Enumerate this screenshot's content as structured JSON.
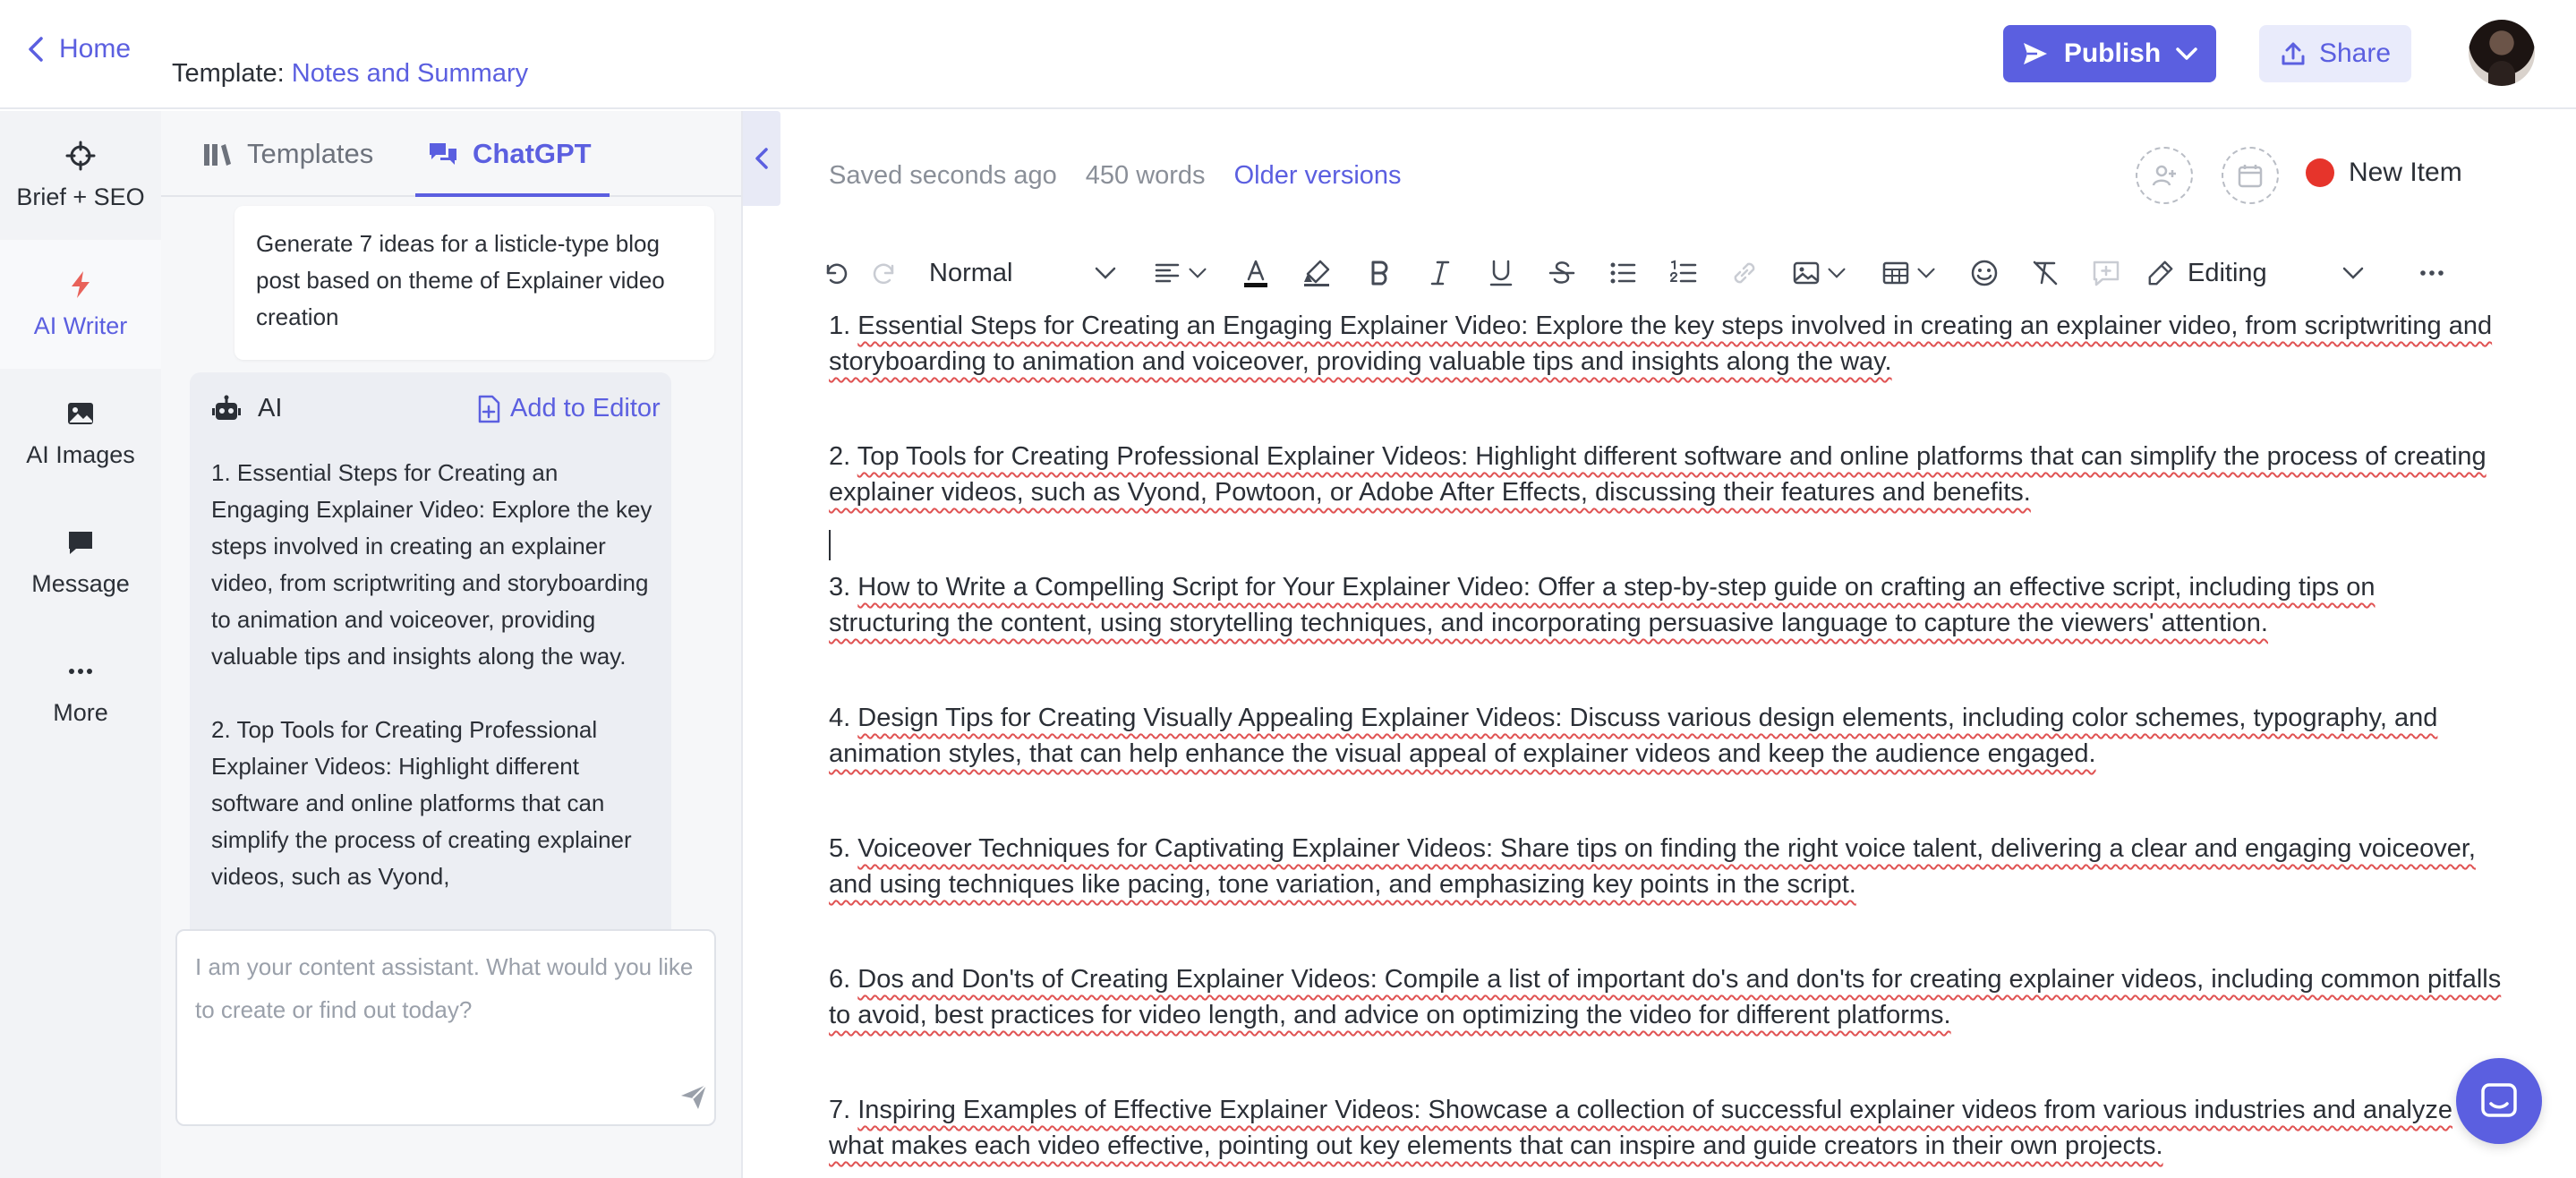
{
  "header": {
    "home_label": "Home",
    "template_prefix": "Template:",
    "template_name": "Notes and Summary",
    "publish_label": "Publish",
    "share_label": "Share"
  },
  "leftnav": {
    "items": [
      {
        "label": "Brief + SEO",
        "icon": "crosshair-icon"
      },
      {
        "label": "AI Writer",
        "icon": "lightning-icon"
      },
      {
        "label": "AI Images",
        "icon": "image-icon"
      },
      {
        "label": "Message",
        "icon": "message-icon"
      },
      {
        "label": "More",
        "icon": "more-icon"
      }
    ]
  },
  "chat": {
    "tabs": [
      {
        "label": "Templates"
      },
      {
        "label": "ChatGPT"
      }
    ],
    "prompt": "Generate 7 ideas for a listicle-type blog post based on theme of Explainer video creation",
    "ai_label": "AI",
    "add_to_editor": "Add to Editor",
    "response": [
      "1. Essential Steps for Creating an Engaging Explainer Video: Explore the key steps involved in creating an explainer video, from scriptwriting and storyboarding to animation and voiceover, providing valuable tips and insights along the way.",
      "2. Top Tools for Creating Professional Explainer Videos: Highlight different software and online platforms that can simplify the process of creating explainer videos, such as Vyond,"
    ],
    "input_placeholder": "I am your content assistant. What would you like to create or find out today?"
  },
  "editor": {
    "saved_status": "Saved seconds ago",
    "word_count": "450 words",
    "older_versions": "Older versions",
    "new_item": "New Item",
    "toolbar": {
      "style_select": "Normal",
      "mode_select": "Editing"
    },
    "items": [
      {
        "num": "1.",
        "text": "Essential Steps for Creating an Engaging Explainer Video: Explore the key steps involved in creating an explainer video, from scriptwriting and storyboarding to animation and voiceover, providing valuable tips and insights along the way."
      },
      {
        "num": "2.",
        "text": "Top Tools for Creating Professional Explainer Videos: Highlight different software and online platforms that can simplify the process of creating explainer videos, such as Vyond, Powtoon, or Adobe After Effects, discussing their features and benefits."
      },
      {
        "num": "3.",
        "text": "How to Write a Compelling Script for Your Explainer Video: Offer a step-by-step guide on crafting an effective script, including tips on structuring the content, using storytelling techniques, and incorporating persuasive language to capture the viewers' attention."
      },
      {
        "num": "4.",
        "text": "Design Tips for Creating Visually Appealing Explainer Videos: Discuss various design elements, including color schemes, typography, and animation styles, that can help enhance the visual appeal of explainer videos and keep the audience engaged."
      },
      {
        "num": "5.",
        "text": "Voiceover Techniques for Captivating Explainer Videos: Share tips on finding the right voice talent, delivering a clear and engaging voiceover, and using techniques like pacing, tone variation, and emphasizing key points in the script."
      },
      {
        "num": "6.",
        "text": "Dos and Don'ts of Creating Explainer Videos: Compile a list of important do's and don'ts for creating explainer videos, including common pitfalls to avoid, best practices for video length, and advice on optimizing the video for different platforms."
      },
      {
        "num": "7.",
        "text": "Inspiring Examples of Effective Explainer Videos: Showcase a collection of successful explainer videos from various industries and analyze what makes each video effective, pointing out key elements that can inspire and guide creators in their own projects."
      }
    ]
  },
  "colors": {
    "accent": "#5b5fe0",
    "new_item_dot": "#e6342b",
    "spellcheck": "#e05353"
  }
}
